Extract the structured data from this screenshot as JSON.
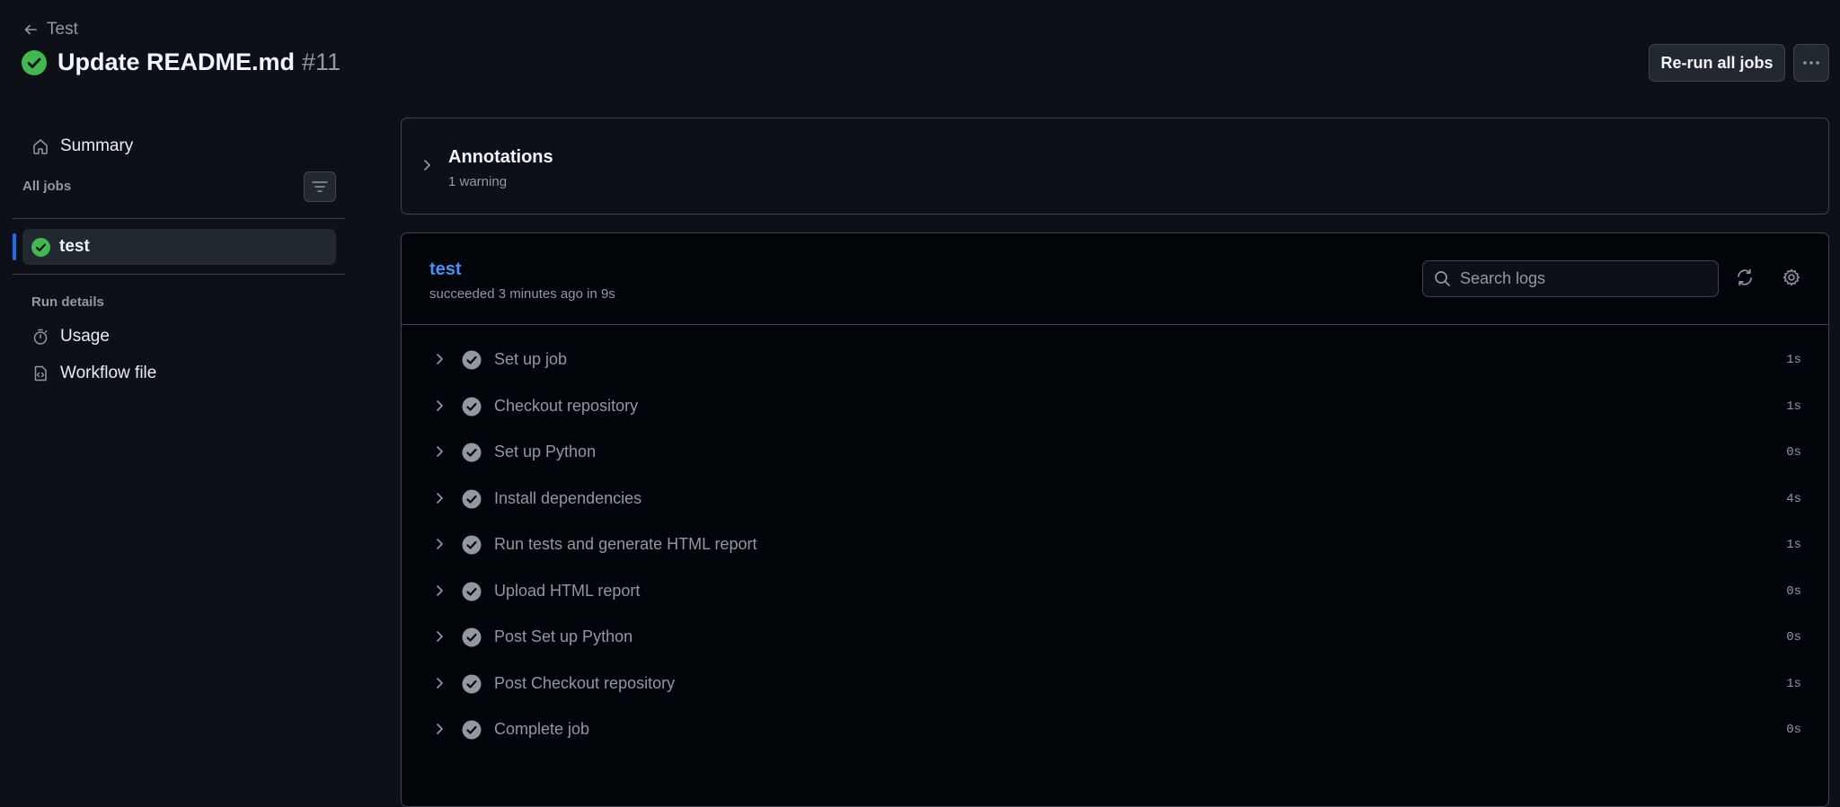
{
  "header": {
    "back_label": "Test",
    "title": "Update README.md",
    "run_number": "#11",
    "rerun_label": "Re-run all jobs"
  },
  "sidebar": {
    "summary_label": "Summary",
    "all_jobs_label": "All jobs",
    "jobs": [
      {
        "name": "test",
        "status": "success"
      }
    ],
    "run_details_label": "Run details",
    "run_details_items": [
      {
        "label": "Usage",
        "icon": "stopwatch-icon"
      },
      {
        "label": "Workflow file",
        "icon": "file-code-icon"
      }
    ]
  },
  "annotations": {
    "title": "Annotations",
    "summary": "1 warning"
  },
  "job": {
    "name": "test",
    "status_text": "succeeded 3 minutes ago in 9s",
    "search_placeholder": "Search logs",
    "steps": [
      {
        "name": "Set up job",
        "duration": "1s"
      },
      {
        "name": "Checkout repository",
        "duration": "1s"
      },
      {
        "name": "Set up Python",
        "duration": "0s"
      },
      {
        "name": "Install dependencies",
        "duration": "4s"
      },
      {
        "name": "Run tests and generate HTML report",
        "duration": "1s"
      },
      {
        "name": "Upload HTML report",
        "duration": "0s"
      },
      {
        "name": "Post Set up Python",
        "duration": "0s"
      },
      {
        "name": "Post Checkout repository",
        "duration": "1s"
      },
      {
        "name": "Complete job",
        "duration": "0s"
      }
    ]
  },
  "colors": {
    "background": "#0d1117",
    "panel": "#010409",
    "border": "#3d444d",
    "success": "#3fb950",
    "link": "#4493f8",
    "accent_bar": "#1f6feb",
    "muted_text": "#9198a1"
  }
}
